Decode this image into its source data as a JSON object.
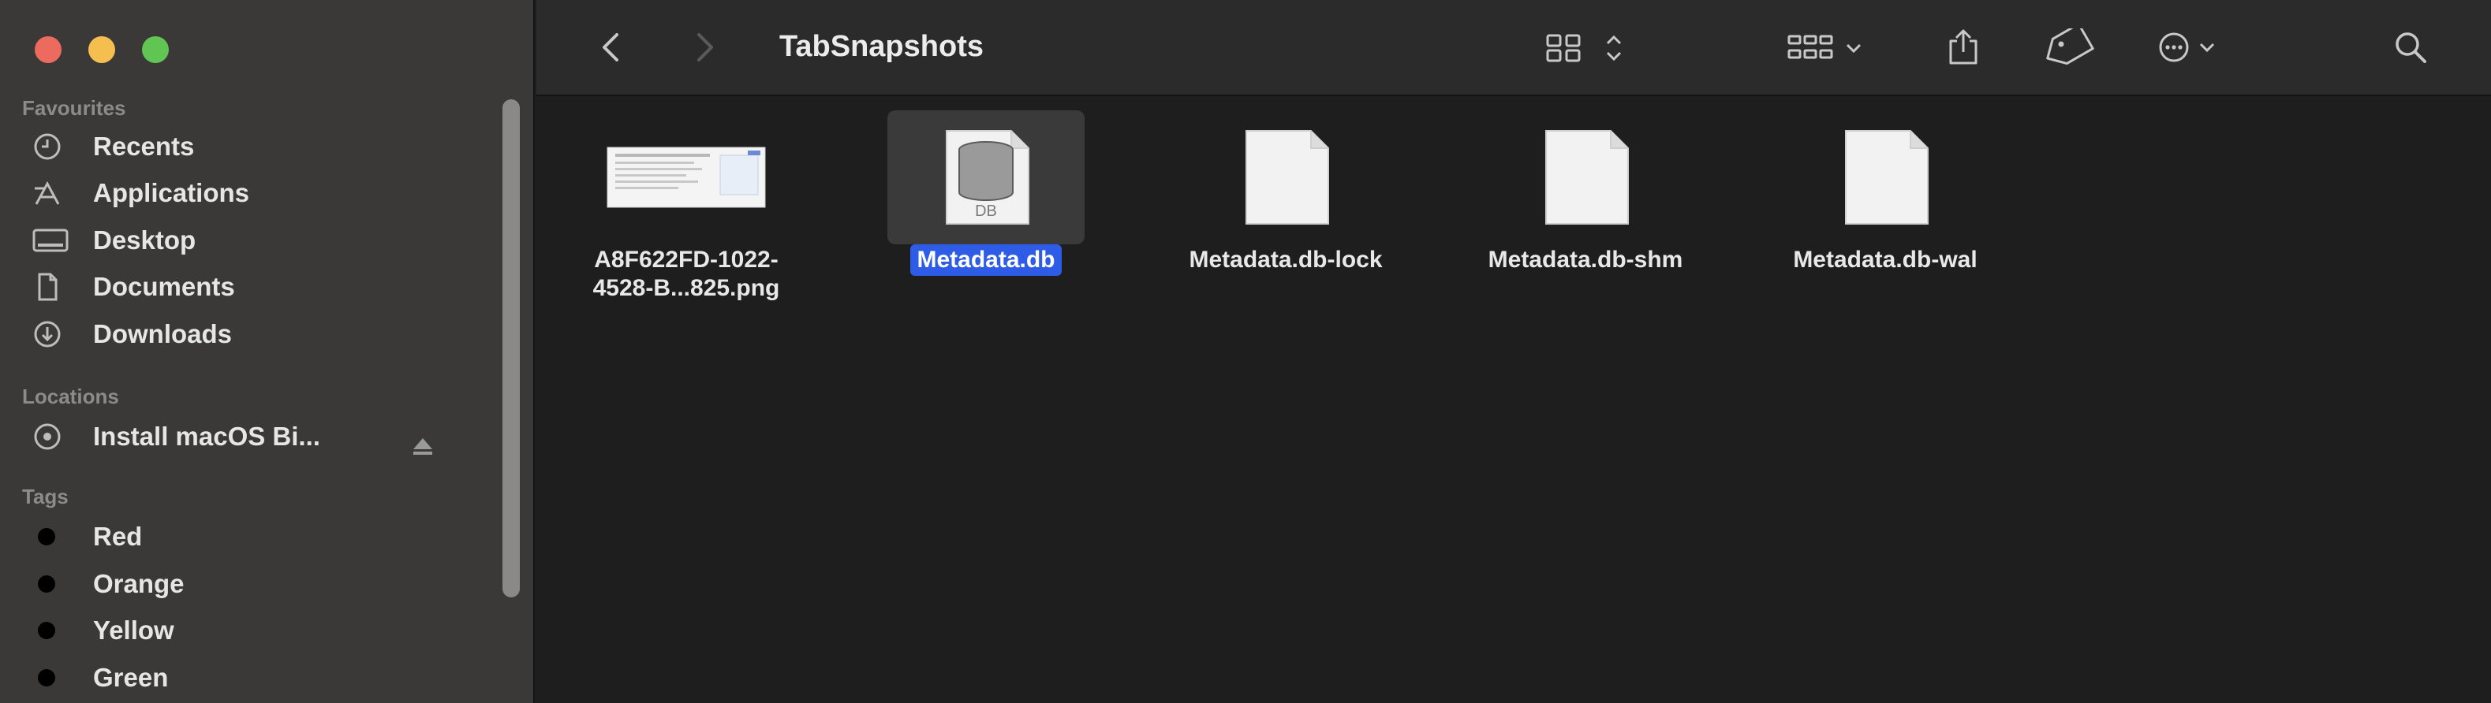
{
  "window": {
    "title": "TabSnapshots"
  },
  "sidebar": {
    "favourites_header": "Favourites",
    "favourites": [
      {
        "label": "Recents",
        "icon": "clock-icon"
      },
      {
        "label": "Applications",
        "icon": "applications-icon"
      },
      {
        "label": "Desktop",
        "icon": "desktop-icon"
      },
      {
        "label": "Documents",
        "icon": "document-icon"
      },
      {
        "label": "Downloads",
        "icon": "download-icon"
      }
    ],
    "locations_header": "Locations",
    "locations": [
      {
        "label": "Install macOS Bi...",
        "icon": "disk-icon"
      }
    ],
    "tags_header": "Tags",
    "tags": [
      {
        "label": "Red"
      },
      {
        "label": "Orange"
      },
      {
        "label": "Yellow"
      },
      {
        "label": "Green"
      }
    ]
  },
  "files": [
    {
      "name_line1": "A8F622FD-1022-",
      "name_line2": "4528-B...825.png",
      "kind": "image-thumbnail",
      "selected": false
    },
    {
      "name_line1": "Metadata.db",
      "name_line2": "",
      "kind": "database",
      "badge": "DB",
      "selected": true
    },
    {
      "name_line1": "Metadata.db-lock",
      "name_line2": "",
      "kind": "document",
      "selected": false
    },
    {
      "name_line1": "Metadata.db-shm",
      "name_line2": "",
      "kind": "document",
      "selected": false
    },
    {
      "name_line1": "Metadata.db-wal",
      "name_line2": "",
      "kind": "document",
      "selected": false
    }
  ],
  "colors": {
    "selection": "#2e5ce6",
    "close": "#ed6a5e",
    "minimize": "#f4bf4f",
    "maximize": "#61c554"
  }
}
